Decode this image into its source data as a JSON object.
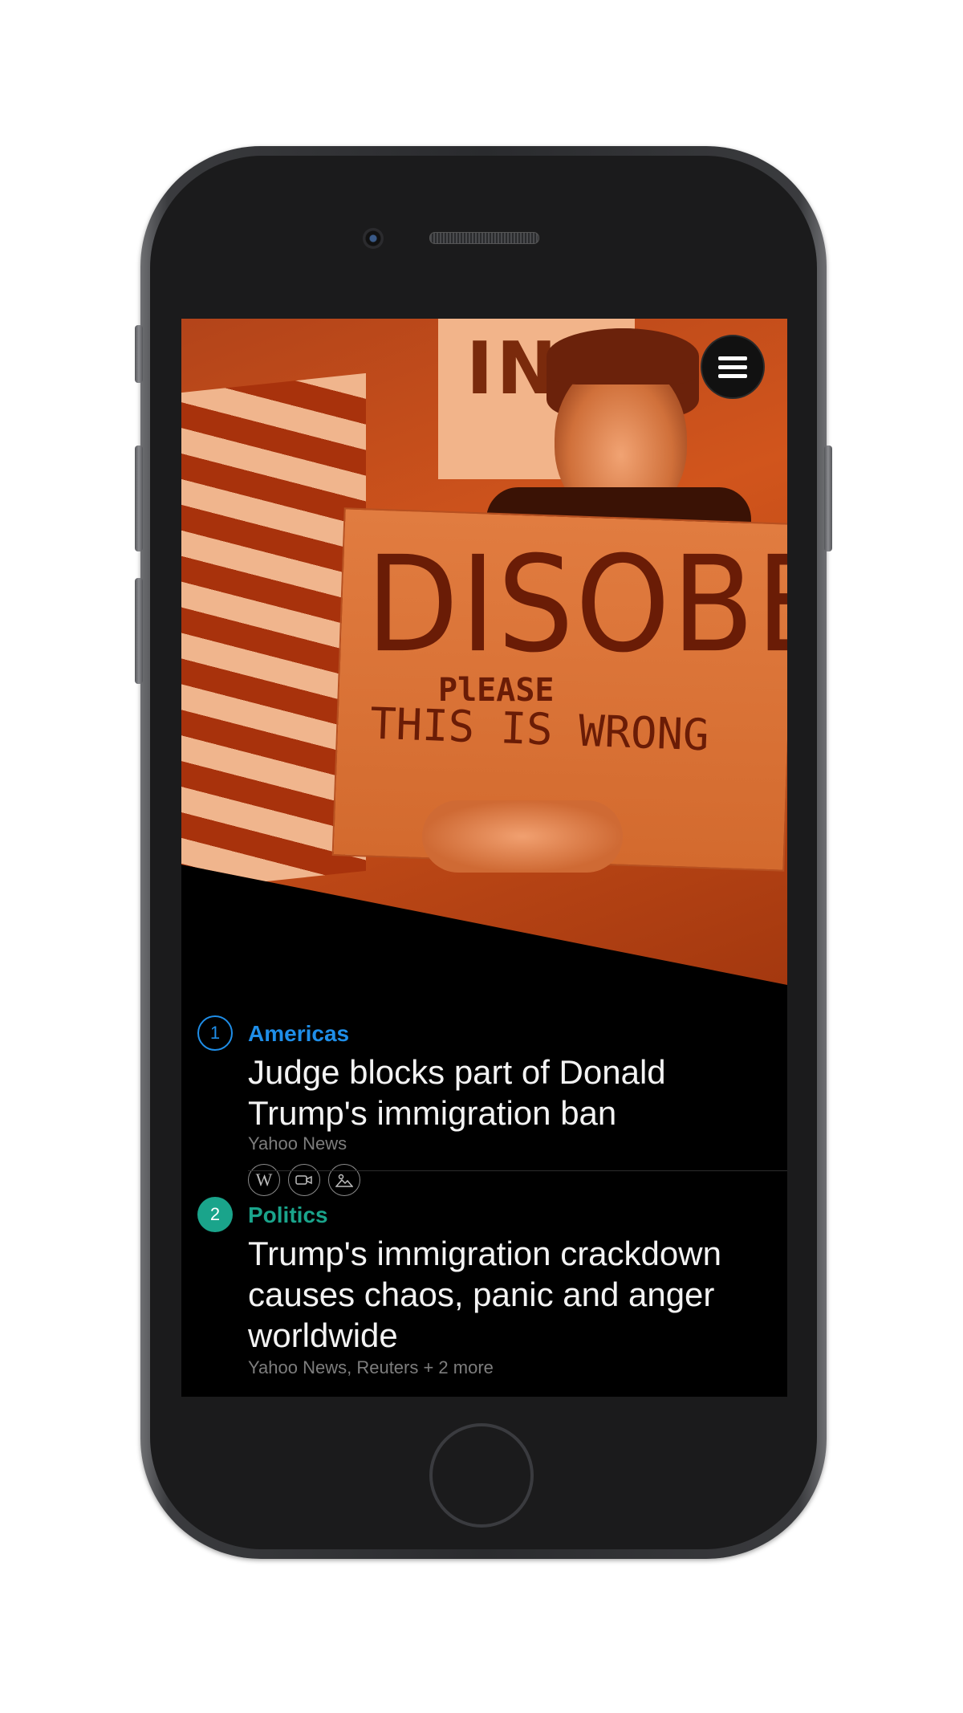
{
  "menu": {
    "icon": "hamburger-menu-icon"
  },
  "hero": {
    "sign_top": "IN",
    "sign_main": "DISOBEY",
    "sign_please": "PlEASE",
    "sign_line": "THIS IS WRONG"
  },
  "stories": [
    {
      "rank": "1",
      "category": "Americas",
      "category_color": "#1f8ee8",
      "headline": "Judge blocks part of Donald Trump's immigration ban",
      "source": "Yahoo News",
      "icons": [
        "wikipedia-icon",
        "video-icon",
        "image-icon"
      ]
    },
    {
      "rank": "2",
      "category": "Politics",
      "category_color": "#1aa48b",
      "headline": "Trump's immigration crackdown causes chaos, panic and anger worldwide",
      "source": "Yahoo News, Reuters + 2 more"
    }
  ],
  "icon_glyphs": {
    "wikipedia": "W"
  }
}
